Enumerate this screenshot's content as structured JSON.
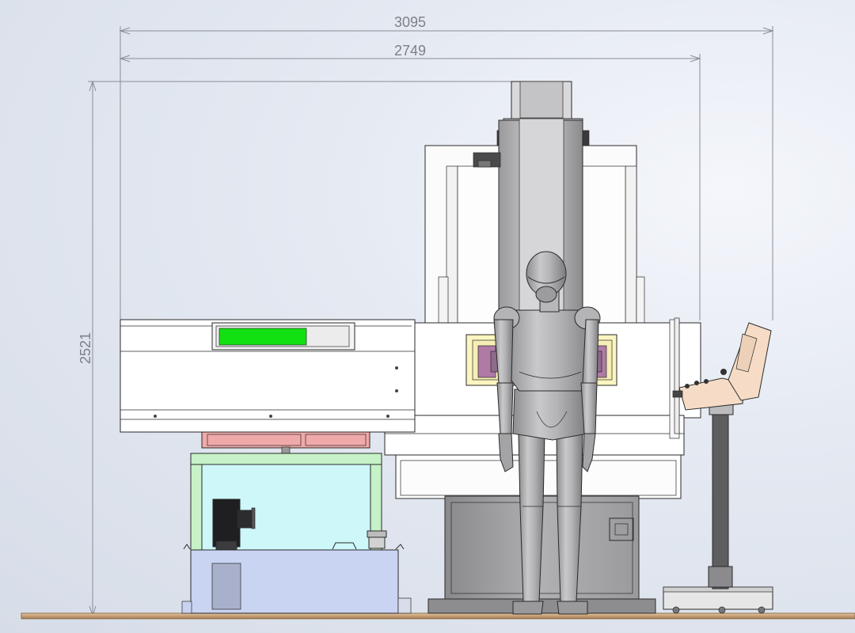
{
  "dimensions": {
    "overall_width": "3095",
    "machine_width": "2749",
    "overall_height": "2521"
  },
  "colors": {
    "indicator_green": "#13e013",
    "coolant_tank": "#c9d3f2",
    "frame_cyan": "#cdf7f9",
    "frame_green": "#c7f2c7",
    "pallet_red": "#f0a9a9",
    "pendant_skin": "#f6dcc6",
    "floor": "#c8a27a",
    "mannequin": "#a9a9ab"
  },
  "indicator": {
    "level_fraction": 0.68
  }
}
